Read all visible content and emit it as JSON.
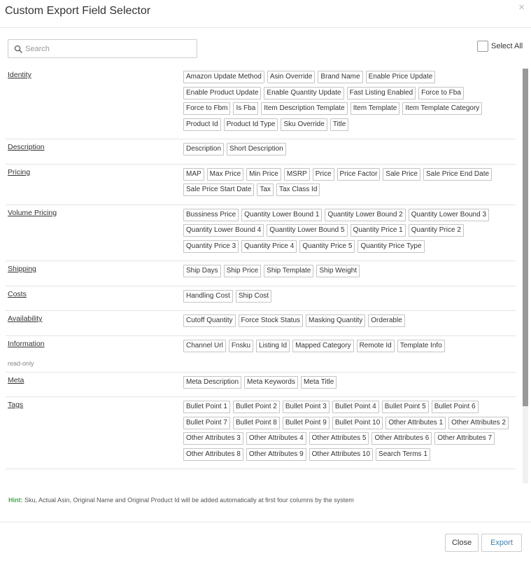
{
  "dialog": {
    "title": "Custom Export Field Selector",
    "close_glyph": "×"
  },
  "search": {
    "placeholder": "Search",
    "value": ""
  },
  "select_all": {
    "label": "Select All",
    "checked": false
  },
  "sections": [
    {
      "label": "Identity",
      "fields": [
        "Amazon Update Method",
        "Asin Override",
        "Brand Name",
        "Enable Price Update",
        "Enable Product Update",
        "Enable Quantity Update",
        "Fast Listing Enabled",
        "Force to Fba",
        "Force to Fbm",
        "Is Fba",
        "Item Description Template",
        "Item Template",
        "Item Template Category",
        "Product Id",
        "Product Id Type",
        "Sku Override",
        "Title"
      ]
    },
    {
      "label": "Description",
      "fields": [
        "Description",
        "Short Description"
      ]
    },
    {
      "label": "Pricing",
      "fields": [
        "MAP",
        "Max Price",
        "Min Price",
        "MSRP",
        "Price",
        "Price Factor",
        "Sale Price",
        "Sale Price End Date",
        "Sale Price Start Date",
        "Tax",
        "Tax Class Id"
      ]
    },
    {
      "label": "Volume Pricing",
      "fields": [
        "Bussiness Price",
        "Quantity Lower Bound 1",
        "Quantity Lower Bound 2",
        "Quantity Lower Bound 3",
        "Quantity Lower Bound 4",
        "Quantity Lower Bound 5",
        "Quantity Price 1",
        "Quantity Price 2",
        "Quantity Price 3",
        "Quantity Price 4",
        "Quantity Price 5",
        "Quantity Price Type"
      ]
    },
    {
      "label": "Shipping",
      "fields": [
        "Ship Days",
        "Ship Price",
        "Ship Template",
        "Ship Weight"
      ]
    },
    {
      "label": "Costs",
      "fields": [
        "Handling Cost",
        "Ship Cost"
      ]
    },
    {
      "label": "Availability",
      "fields": [
        "Cutoff Quantity",
        "Force Stock Status",
        "Masking Quantity",
        "Orderable"
      ]
    },
    {
      "label": "Information",
      "note": "read-only",
      "fields": [
        "Channel Url",
        "Fnsku",
        "Listing Id",
        "Mapped Category",
        "Remote Id",
        "Template Info"
      ]
    },
    {
      "label": "Meta",
      "fields": [
        "Meta Description",
        "Meta Keywords",
        "Meta Title"
      ]
    },
    {
      "label": "Tags",
      "fields": [
        "Bullet Point 1",
        "Bullet Point 2",
        "Bullet Point 3",
        "Bullet Point 4",
        "Bullet Point 5",
        "Bullet Point 6",
        "Bullet Point 7",
        "Bullet Point 8",
        "Bullet Point 9",
        "Bullet Point 10",
        "Other Attributes 1",
        "Other Attributes 2",
        "Other Attributes 3",
        "Other Attributes 4",
        "Other Attributes 5",
        "Other Attributes 6",
        "Other Attributes 7",
        "Other Attributes 8",
        "Other Attributes 9",
        "Other Attributes 10",
        "Search Terms 1"
      ]
    }
  ],
  "hint": {
    "label": "Hint:",
    "text": " Sku, Actual Asin, Original Name and Original Product Id will be added automatically at first four columns by the system"
  },
  "footer": {
    "close_label": "Close",
    "export_label": "Export"
  },
  "colors": {
    "hint_label": "#3cb043",
    "export_text": "#3e7fae",
    "scroll_thumb": "#999999"
  }
}
